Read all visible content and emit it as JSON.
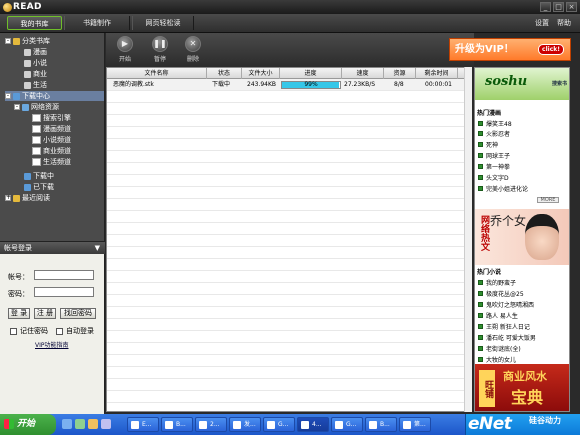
{
  "app": {
    "logo_text": "READ",
    "window_buttons": [
      "_",
      "□",
      "×"
    ]
  },
  "menubar": {
    "tabs": [
      {
        "label": "我的书库"
      },
      {
        "label": "书籍制作"
      },
      {
        "label": "网页轻松读"
      }
    ],
    "settings": "设置",
    "help": "帮助"
  },
  "tree": {
    "library": "分类书库",
    "comics": "漫画",
    "novels": "小说",
    "business": "商业",
    "life": "生活",
    "download_center": "下载中心",
    "web_resources": "网络资源",
    "search_engine": "搜索引擎",
    "comic_channel": "漫画频道",
    "novel_channel": "小说频道",
    "business_channel": "商业频道",
    "life_channel": "生活频道",
    "downloading": "下载中",
    "downloaded": "已下载",
    "recent": "最近阅读"
  },
  "login": {
    "header": "帐号登录",
    "account_label": "帐号：",
    "password_label": "密码：",
    "login_button": "登 录",
    "register_button": "注 册",
    "recover_button": "找回密码",
    "remember_password": "记住密码",
    "auto_login": "自动登录",
    "vip_guide": "VIP功能指南"
  },
  "toolbar": {
    "start": "开始",
    "pause": "暂停",
    "delete": "删除"
  },
  "table": {
    "columns": [
      "文件名称",
      "状态",
      "文件大小",
      "进度",
      "速度",
      "资源",
      "剩余时间"
    ],
    "rows": [
      {
        "name": "恶魔的调教.stk",
        "status": "下载中",
        "size": "243.94KB",
        "progress_text": "99%",
        "progress": 0.99,
        "speed": "27.23KB/S",
        "resources": "8/8",
        "remaining": "00:00:01"
      }
    ]
  },
  "ad": {
    "vip_banner": "升级为VIP！",
    "vip_click": "click!",
    "logo": "soshu",
    "logo_small": "搜索书",
    "hot_comics_title": "热门漫画",
    "hot_comics": [
      "爆笑王48",
      "火影忍者",
      "死神",
      "网球王子",
      "第一神拳",
      "头文字D",
      "完美小姐进化论"
    ],
    "more": "MORE",
    "banner1_side": "网络热文",
    "banner1_title": "乔个女",
    "hot_novels_title": "热门小说",
    "hot_novels": [
      "我的野蛮子",
      "极度花丛@25",
      "鬼吹灯之怒晴湘西",
      "路人 易人生",
      "王朔 新狂人日记",
      "潘石屹 可爱大饭男",
      "老街谜底(全)",
      "大牧的女儿"
    ],
    "banner2_side": "旺铺",
    "banner2_line1": "商业风水",
    "banner2_line2": "宝典"
  },
  "taskbar": {
    "start": "开始",
    "tasks": [
      "E...",
      "B...",
      "2...",
      "发...",
      "G...",
      "4...",
      "G...",
      "B...",
      "第..."
    ],
    "watermark_logo": "eNet",
    "watermark_text": "硅谷动力"
  },
  "colors": {
    "progress": "#36c7e8",
    "accent_green": "#6fbf2a",
    "vip_orange": "#ff7a2a"
  }
}
